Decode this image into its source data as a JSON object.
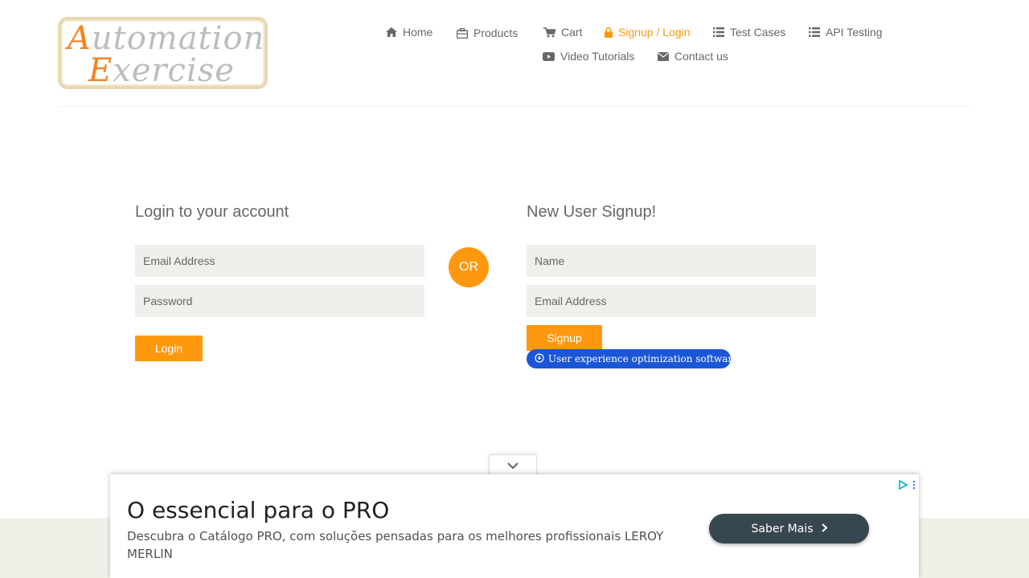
{
  "logo": {
    "line1_cap": "A",
    "line1_rest": "utomation",
    "line2_cap": "E",
    "line2_rest": "xercise"
  },
  "nav": {
    "home": "Home",
    "products": "Products",
    "cart": "Cart",
    "signup_login": "Signup / Login",
    "test_cases": "Test Cases",
    "api_testing": "API Testing",
    "video_tutorials": "Video Tutorials",
    "contact_us": "Contact us"
  },
  "colors": {
    "accent": "#fe980f",
    "field_bg": "#f0efeb",
    "text": "#696763",
    "badge": "#1a56d6",
    "ad_cta": "#37474f"
  },
  "login": {
    "title": "Login to your account",
    "email_placeholder": "Email Address",
    "password_placeholder": "Password",
    "button": "Login"
  },
  "or_label": "OR",
  "signup": {
    "title": "New User Signup!",
    "name_placeholder": "Name",
    "email_placeholder": "Email Address",
    "button": "Signup"
  },
  "badge": {
    "text": "User experience optimization software"
  },
  "ad": {
    "title": "O essencial para o PRO",
    "description": "Descubra o Catálogo PRO, com soluções pensadas para os melhores profissionais LEROY MERLIN",
    "cta": "Saber Mais"
  }
}
